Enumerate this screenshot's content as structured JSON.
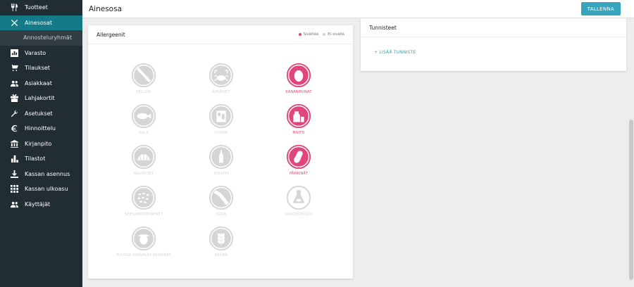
{
  "sidebar": {
    "items": [
      {
        "label": "Tuotteet",
        "icon": "cutlery-icon"
      },
      {
        "label": "Ainesosat",
        "icon": "tools-icon",
        "active": true
      },
      {
        "label": "Annosteluryhmät",
        "sub": true
      },
      {
        "label": "Varasto",
        "icon": "warehouse-icon"
      },
      {
        "label": "Tilaukset",
        "icon": "cart-icon"
      },
      {
        "label": "Asiakkaat",
        "icon": "users-icon"
      },
      {
        "label": "Lahjakortit",
        "icon": "gift-icon"
      },
      {
        "label": "Asetukset",
        "icon": "wrench-icon"
      },
      {
        "label": "Hinnoittelu",
        "icon": "euro-icon"
      },
      {
        "label": "Kirjanpito",
        "icon": "bank-icon"
      },
      {
        "label": "Tilastot",
        "icon": "bar-chart-icon"
      },
      {
        "label": "Kassan asennus",
        "icon": "download-icon"
      },
      {
        "label": "Kassan ulkoasu",
        "icon": "grid-icon"
      },
      {
        "label": "Käyttäjät",
        "icon": "users-icon"
      }
    ]
  },
  "header": {
    "title": "Ainesosa",
    "save_label": "TALLENNA"
  },
  "allergens_card": {
    "title": "Allergeenit",
    "legend_contains": "Sisältää",
    "legend_not_contains": "Ei sisällä",
    "items": [
      {
        "label": "SELLERI",
        "icon": "celery-icon",
        "contains": false
      },
      {
        "label": "ÄYRÄISET",
        "icon": "crab-icon",
        "contains": false
      },
      {
        "label": "KANANMUNAT",
        "icon": "egg-icon",
        "contains": true
      },
      {
        "label": "KALA",
        "icon": "fish-icon",
        "contains": false
      },
      {
        "label": "LUPIINI",
        "icon": "lupin-icon",
        "contains": false
      },
      {
        "label": "MAITO",
        "icon": "milk-icon",
        "contains": true
      },
      {
        "label": "NILVIÄISET",
        "icon": "shell-icon",
        "contains": false
      },
      {
        "label": "SINAPPI",
        "icon": "mustard-icon",
        "contains": false
      },
      {
        "label": "PÄHKINÄT",
        "icon": "nut-icon",
        "contains": true
      },
      {
        "label": "SEESAMINSIEMENET",
        "icon": "sesame-icon",
        "contains": false
      },
      {
        "label": "SOIJA",
        "icon": "soy-icon",
        "contains": false
      },
      {
        "label": "RIKKIDIOKSIDI",
        "icon": "sulphite-icon",
        "contains": false
      },
      {
        "label": "PUUSSA KASVAVAT PÄHKINÄT",
        "icon": "tree-nut-icon",
        "contains": false
      },
      {
        "label": "VEHNÄ",
        "icon": "wheat-icon",
        "contains": false
      }
    ]
  },
  "tags_card": {
    "title": "Tunnisteet",
    "add_label": "+ LISÄÄ TUNNISTE"
  },
  "colors": {
    "accent": "#36a4bd",
    "contains": "#e0457b",
    "not_contains": "#d5d5d5",
    "sidebar": "#222c33",
    "sidebar_active": "#147a87"
  }
}
